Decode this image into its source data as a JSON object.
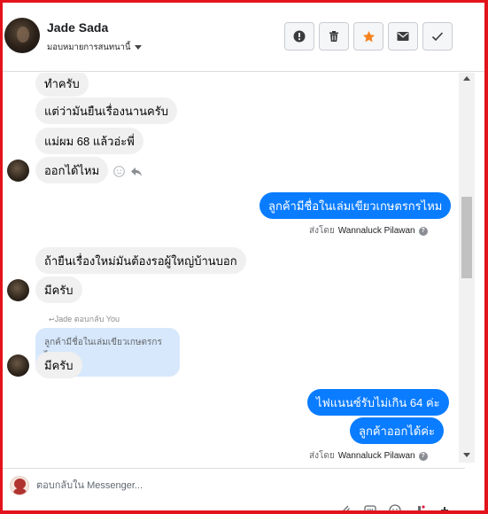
{
  "header": {
    "contact_name": "Jade Sada",
    "assign_label": "มอบหมายการสนทนานี้",
    "toolbar": [
      {
        "name": "spam-alert-button",
        "icon": "alert-circle-icon"
      },
      {
        "name": "delete-button",
        "icon": "trash-icon"
      },
      {
        "name": "star-button",
        "icon": "star-icon"
      },
      {
        "name": "mark-unread-button",
        "icon": "envelope-icon"
      },
      {
        "name": "mark-done-button",
        "icon": "check-icon"
      }
    ]
  },
  "messages": {
    "m1": "ทำครับ",
    "m2": "แต่ว่ามันยืนเรื่องนานครับ",
    "m3": "แม่ผม 68 แล้วอ่ะพี่",
    "m4": "ออกได้ไหม",
    "m5": "ลูกค้ามีชื่อในเล่มเขียวเกษตรกรไหม",
    "m6": "ถ้ายืนเรื่องใหม่มันต้องรอผู้ใหญ่บ้านบอก",
    "m7": "มีครับ",
    "m8": "มีครับ",
    "m9": "ไฟแนนซ์รับไม่เกิน 64 ค่ะ",
    "m10": "ลูกค้าออกได้ค่ะ"
  },
  "sent_by": {
    "prefix": "ส่งโดย",
    "agent": "Wannaluck Pilawan",
    "help_glyph": "?"
  },
  "reply": {
    "note": "Jade ตอบกลับ You",
    "quoted_text": "ลูกค้ามีชื่อในเล่มเขียวเกษตรกรไหม"
  },
  "composer": {
    "placeholder": "ตอบกลับใน Messenger..."
  },
  "colors": {
    "outgoing": "#0a7cff",
    "incoming": "#f0f0f0",
    "star": "#f5821f",
    "frame": "#e3131b"
  }
}
